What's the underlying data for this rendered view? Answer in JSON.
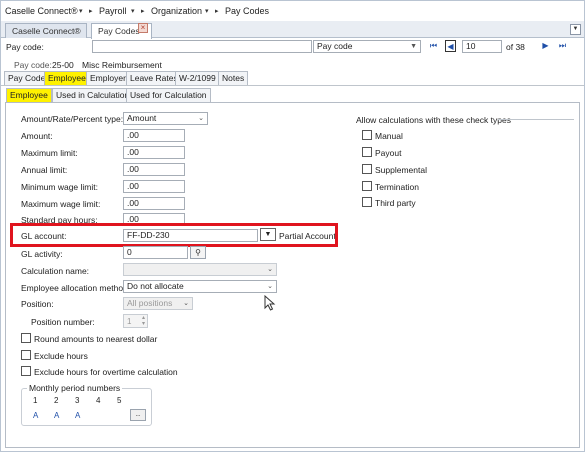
{
  "breadcrumb": {
    "items": [
      "Caselle Connect®",
      "Payroll",
      "Organization",
      "Pay Codes"
    ]
  },
  "doc_tabs": [
    {
      "label": "Caselle Connect®",
      "active": false
    },
    {
      "label": "Pay Codes",
      "active": true
    }
  ],
  "search": {
    "label": "Pay code:",
    "value": "",
    "lookup_by": "Pay code",
    "record": "10",
    "of_total": "of 38"
  },
  "header": {
    "code_label": "Pay code:",
    "code": "25-00",
    "description": "Misc Reimbursement"
  },
  "main_tabs": [
    "Pay Code",
    "Employee",
    "Employer",
    "Leave Rates",
    "W-2/1099",
    "Notes"
  ],
  "sub_tabs": [
    "Employee",
    "Used in Calculations",
    "Used for Calculation"
  ],
  "form": {
    "amount_type_label": "Amount/Rate/Percent type:",
    "amount_type_value": "Amount",
    "amount_label": "Amount:",
    "amount_value": ".00",
    "max_limit_label": "Maximum limit:",
    "max_limit_value": ".00",
    "annual_limit_label": "Annual limit:",
    "annual_limit_value": ".00",
    "min_wage_label": "Minimum wage limit:",
    "min_wage_value": ".00",
    "max_wage_label": "Maximum wage limit:",
    "max_wage_value": ".00",
    "std_hours_label": "Standard pay hours:",
    "std_hours_value": ".00",
    "gl_account_label": "GL account:",
    "gl_account_value": "FF-DD-230",
    "partial_account": "Partial Account",
    "gl_activity_label": "GL activity:",
    "gl_activity_value": "0",
    "calc_name_label": "Calculation name:",
    "calc_name_value": "",
    "emp_alloc_label": "Employee allocation method:",
    "emp_alloc_value": "Do not allocate",
    "position_label": "Position:",
    "position_value": "All positions",
    "position_number_label": "Position number:",
    "position_number_value": "1",
    "round_label": "Round amounts to nearest dollar",
    "exclude_hours_label": "Exclude hours",
    "exclude_ot_label": "Exclude hours for overtime calculation"
  },
  "monthly": {
    "title": "Monthly period numbers",
    "numbers": [
      "1",
      "2",
      "3",
      "4",
      "5"
    ],
    "values": [
      "A",
      "A",
      "A"
    ],
    "more": ".."
  },
  "allow": {
    "title": "Allow calculations with these check types",
    "items": [
      "Manual",
      "Payout",
      "Supplemental",
      "Termination",
      "Third party"
    ]
  },
  "colors": {
    "highlight": "#fff200",
    "annotation": "#e0141e",
    "link": "#1f4fa8"
  }
}
